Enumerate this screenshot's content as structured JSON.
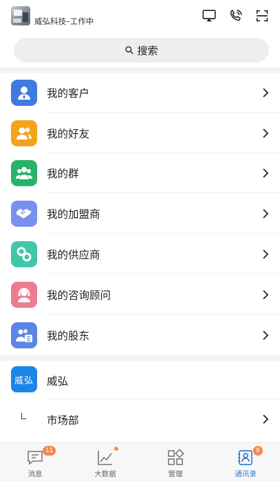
{
  "header": {
    "org_name": "威弘科技–工作中",
    "icons": [
      "screen-cast-icon",
      "phone-call-icon",
      "scan-icon"
    ]
  },
  "search": {
    "label": "搜索"
  },
  "contacts": [
    {
      "label": "我的客户",
      "icon": "customer-icon",
      "color": "#3f7ce0"
    },
    {
      "label": "我的好友",
      "icon": "friends-icon",
      "color": "#f2a41c"
    },
    {
      "label": "我的群",
      "icon": "group-icon",
      "color": "#27b26c"
    },
    {
      "label": "我的加盟商",
      "icon": "handshake-icon",
      "color": "#7b8ff0"
    },
    {
      "label": "我的供应商",
      "icon": "link-icon",
      "color": "#3fc7a8"
    },
    {
      "label": "我的咨询顾问",
      "icon": "consultant-icon",
      "color": "#ef7c8e"
    },
    {
      "label": "我的股东",
      "icon": "shareholder-icon",
      "color": "#5b86e5"
    }
  ],
  "organization": {
    "logo_text": "威弘",
    "name": "威弘",
    "department": "市场部"
  },
  "tabbar": [
    {
      "label": "消息",
      "icon": "message-icon",
      "badge": "11"
    },
    {
      "label": "大数据",
      "icon": "chart-icon",
      "dot": true
    },
    {
      "label": "管理",
      "icon": "grid-icon"
    },
    {
      "label": "通讯录",
      "icon": "contacts-icon",
      "badge": "6",
      "active": true
    }
  ]
}
